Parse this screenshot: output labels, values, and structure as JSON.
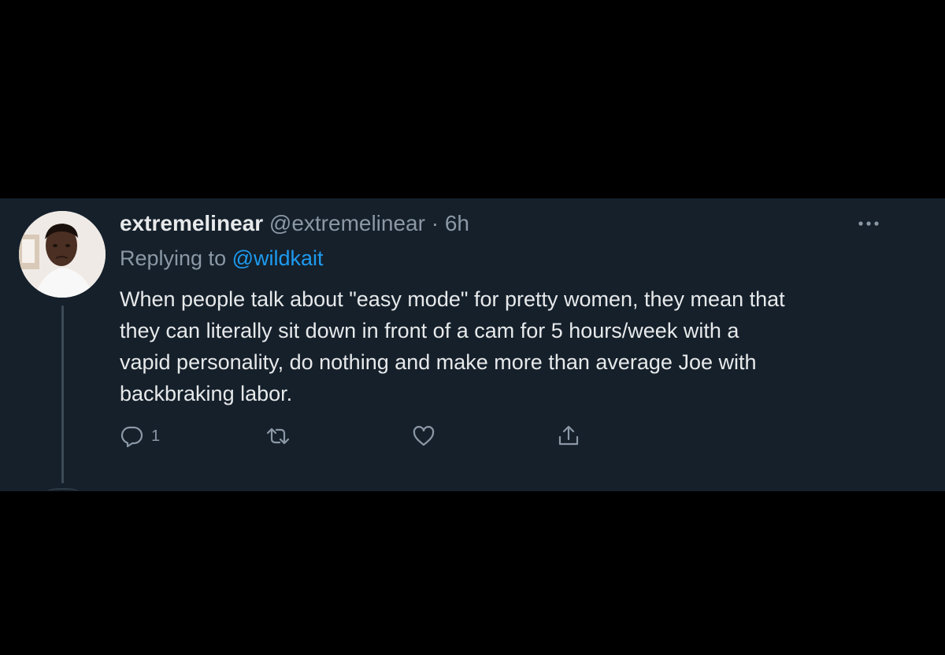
{
  "tweet": {
    "display_name": "extremelinear",
    "handle": "@extremelinear",
    "separator": "·",
    "time": "6h",
    "replying_prefix": "Replying to",
    "replying_to": "@wildkait",
    "text_lines": [
      "When people talk about \"easy mode\" for pretty women, they mean that",
      "they can literally sit down in front of a cam for 5 hours/week with a",
      "vapid personality, do nothing and make more than average Joe with",
      "backbraking labor."
    ],
    "actions": {
      "reply_count": "1"
    }
  },
  "colors": {
    "background": "#000000",
    "card": "#15202b",
    "primary_text": "#e7e9ea",
    "secondary_text": "#8b98a5",
    "accent": "#1d9bf0"
  },
  "icons": [
    "more-icon",
    "reply-icon",
    "retweet-icon",
    "like-icon",
    "share-icon"
  ]
}
